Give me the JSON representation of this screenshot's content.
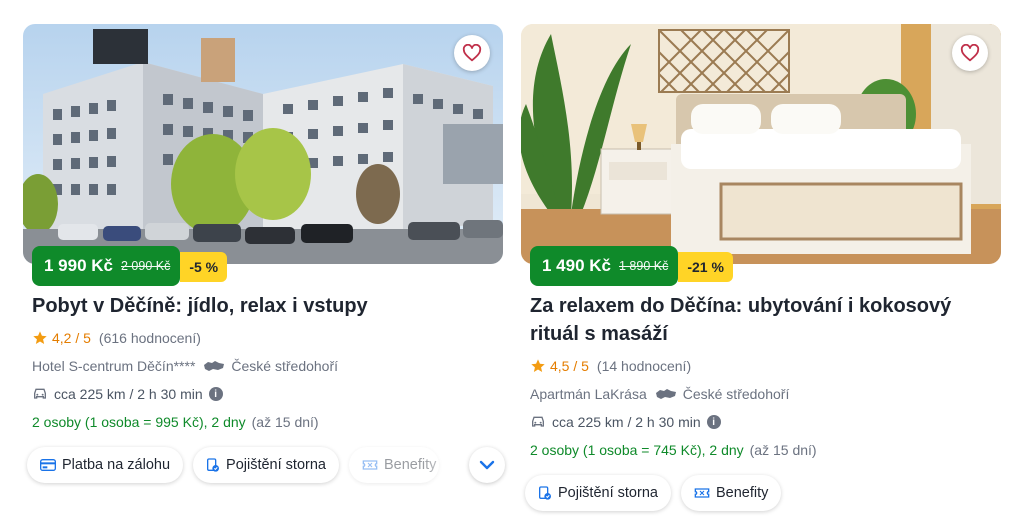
{
  "colors": {
    "price_green": "#0f8a2a",
    "discount_yellow": "#ffd426",
    "rating_orange": "#e47d00",
    "link_blue": "#1a73e8"
  },
  "cards": [
    {
      "price_now": "1 990 Kč",
      "price_old": "2 090 Kč",
      "discount": "-5 %",
      "title": "Pobyt v Děčíně: jídlo, relax i vstupy",
      "rating": "4,2 / 5",
      "rating_count": "(616 hodnocení)",
      "hotel": "Hotel S-centrum Děčín****",
      "region": "České středohoří",
      "distance": "cca 225 km / 2 h 30 min",
      "persons": "2 osoby (1 osoba = 995 Kč), 2 dny",
      "nights": "(až 15 dní)",
      "chips": [
        "Platba na zálohu",
        "Pojištění storna",
        "Benefity"
      ],
      "photo_icon": "hotel-building-photo"
    },
    {
      "price_now": "1 490 Kč",
      "price_old": "1 890 Kč",
      "discount": "-21 %",
      "title_line1": "Za relaxem do Děčína: ubytování i kokosový",
      "title_line2": "rituál s masáží",
      "rating": "4,5 / 5",
      "rating_count": "(14 hodnocení)",
      "hotel": "Apartmán LaKrása",
      "region": "České středohoří",
      "distance": "cca 225 km / 2 h 30 min",
      "persons": "2 osoby (1 osoba = 745 Kč), 2 dny",
      "nights": "(až 15 dní)",
      "chips": [
        "Pojištění storna",
        "Benefity"
      ],
      "photo_icon": "bedroom-photo"
    }
  ]
}
